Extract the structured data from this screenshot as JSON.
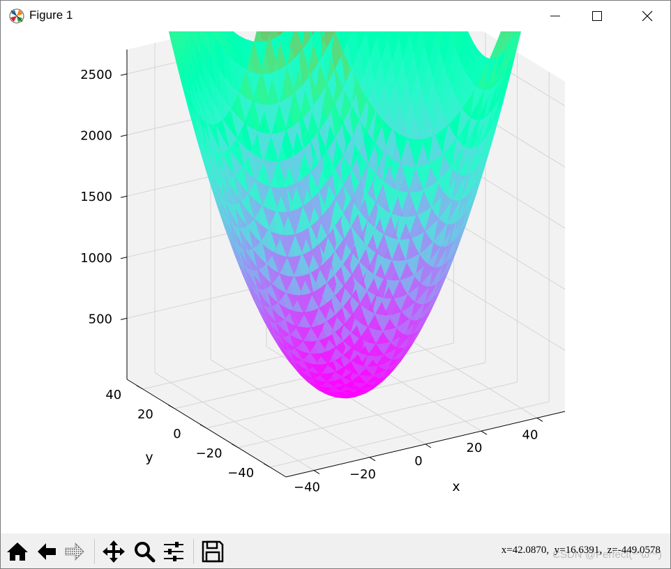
{
  "window": {
    "title": "Figure 1"
  },
  "toolbar": {
    "buttons": [
      {
        "name": "home-icon"
      },
      {
        "name": "back-arrow-icon"
      },
      {
        "name": "forward-arrow-icon"
      },
      {
        "name": "pan-icon"
      },
      {
        "name": "zoom-icon"
      },
      {
        "name": "configure-subplots-icon"
      },
      {
        "name": "save-icon"
      }
    ],
    "status": "x=42.0870,  y=16.6391,  z=-449.0578",
    "watermark": "CSDN @Perfect(*^ω^*)"
  },
  "chart_data": {
    "type": "surface",
    "function": "z = x^2 + y^2",
    "colormap": "rainbow",
    "xlabel": "x",
    "ylabel": "y",
    "zlabel": "",
    "x_ticks": [
      "−40",
      "−20",
      "0",
      "20",
      "40"
    ],
    "y_ticks": [
      "−40",
      "−20",
      "0",
      "20",
      "40"
    ],
    "z_ticks": [
      "500",
      "1000",
      "1500",
      "2000",
      "2500"
    ],
    "xlim": [
      -50,
      50
    ],
    "ylim": [
      -50,
      50
    ],
    "zlim": [
      0,
      2700
    ],
    "grid": true
  },
  "colors": {
    "pane": "#f2f2f2",
    "grid": "#d4d4d4",
    "toolbar_bg": "#f0f0f0"
  }
}
